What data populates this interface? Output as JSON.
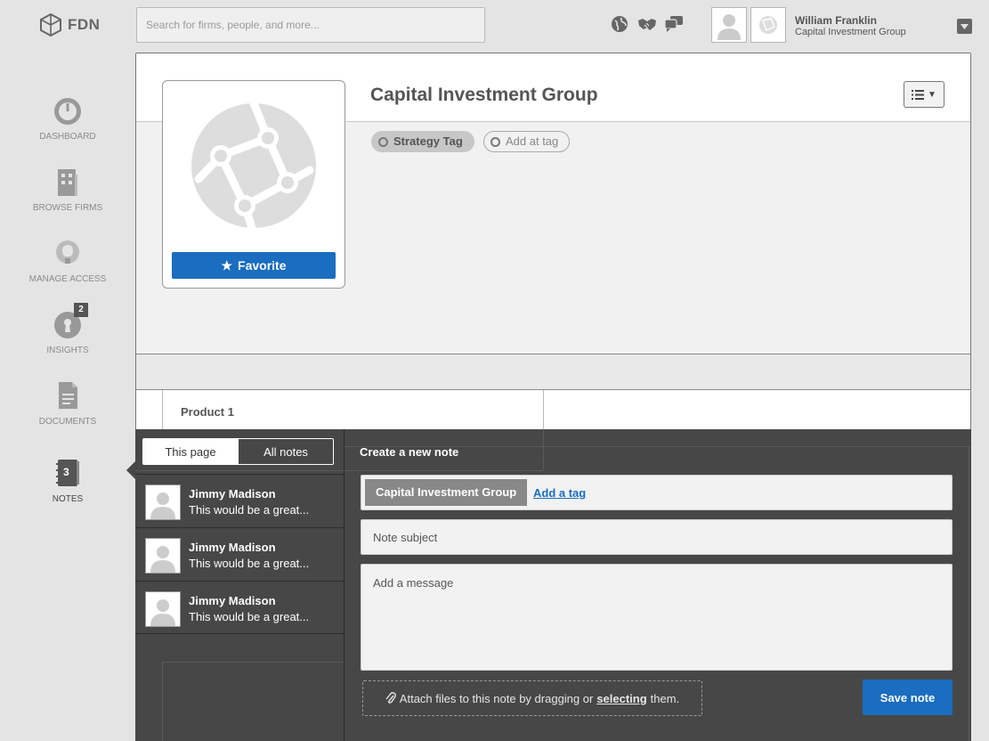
{
  "brand": {
    "name": "FDN"
  },
  "search": {
    "placeholder": "Search for firms, people, and more..."
  },
  "user": {
    "name": "William Franklin",
    "company": "Capital Investment Group"
  },
  "sidebar": {
    "items": [
      {
        "label": "DASHBOARD",
        "icon": "gauge-icon"
      },
      {
        "label": "BROWSE FIRMS",
        "icon": "building-icon"
      },
      {
        "label": "MANAGE ACCESS",
        "icon": "lightbulb-icon"
      },
      {
        "label": "INSIGHTS",
        "icon": "keyhole-icon",
        "badge": "2"
      },
      {
        "label": "DOCUMENTS",
        "icon": "document-icon"
      },
      {
        "label": "NOTES",
        "icon": "notebook-icon",
        "badge": "3",
        "active": true
      }
    ]
  },
  "firm": {
    "name": "Capital Investment Group",
    "favorite_label": "Favorite",
    "tags": [
      "Strategy Tag"
    ],
    "add_tag_label": "Add at tag"
  },
  "product": {
    "label": "Product 1"
  },
  "notes": {
    "tabs": [
      "This page",
      "All notes"
    ],
    "active_tab": "This page",
    "list": [
      {
        "author": "Jimmy Madison",
        "preview": "This would be a great..."
      },
      {
        "author": "Jimmy Madison",
        "preview": "This would be a great..."
      },
      {
        "author": "Jimmy Madison",
        "preview": "This would be a great..."
      }
    ],
    "create_title": "Create a new note",
    "firm_tag": "Capital Investment Group",
    "add_tag_link": "Add a tag",
    "subject_placeholder": "Note subject",
    "message_placeholder": "Add a message",
    "attach_prefix": "Attach files to this note by dragging or",
    "attach_link": "selecting",
    "attach_suffix": "them.",
    "save_label": "Save note"
  },
  "colors": {
    "accent": "#1a6dbf",
    "panel": "#474747",
    "background": "#e4e4e4"
  }
}
